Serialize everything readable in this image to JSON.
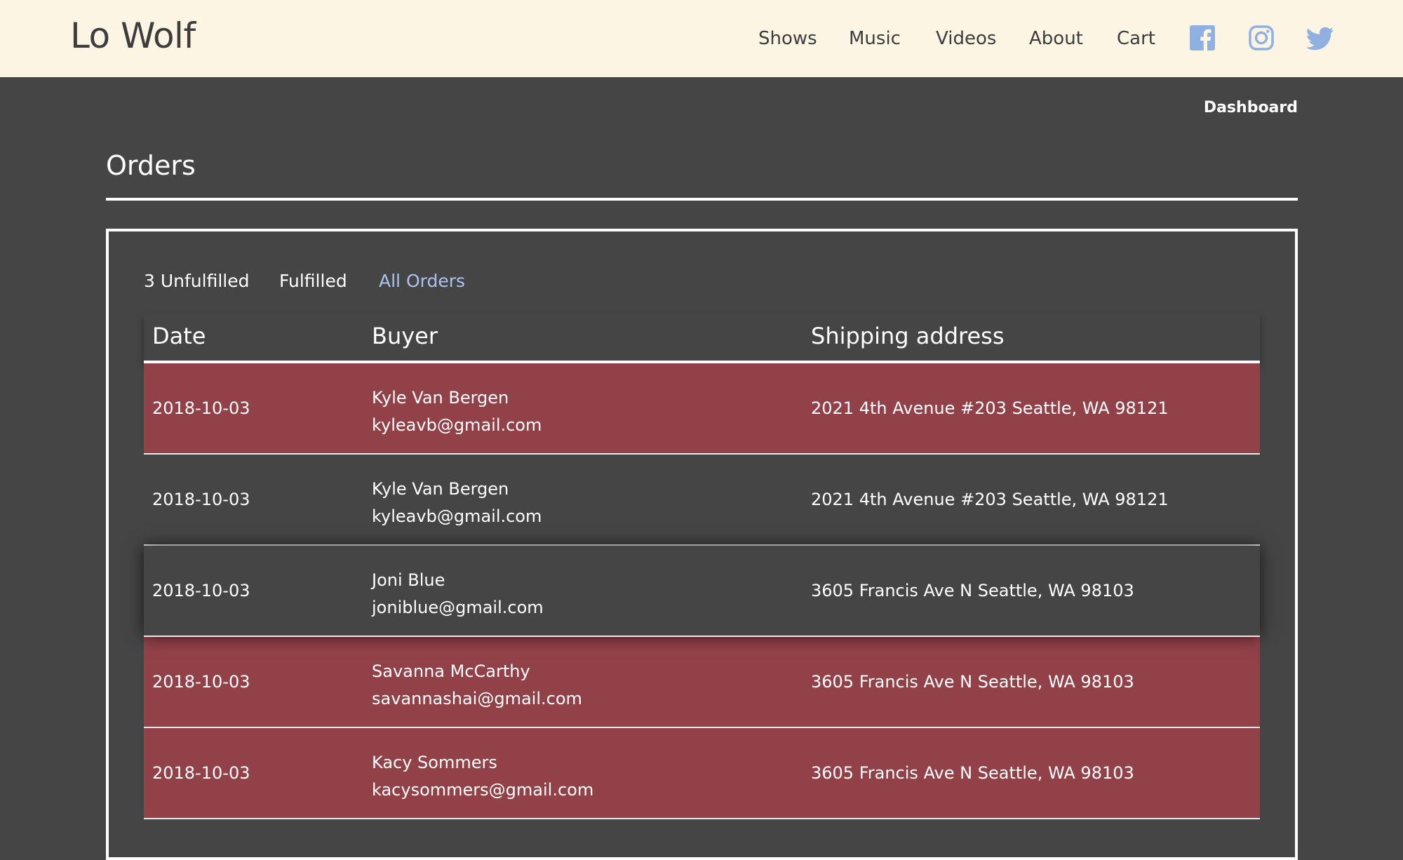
{
  "header": {
    "brand": "Lo Wolf",
    "nav": [
      "Shows",
      "Music",
      "Videos",
      "About",
      "Cart"
    ],
    "social_icons": [
      "facebook-icon",
      "instagram-icon",
      "twitter-icon"
    ],
    "social_color": "#8fb0e0"
  },
  "dashboard_link": "Dashboard",
  "page_title": "Orders",
  "tabs": [
    "3 Unfulfilled",
    "Fulfilled",
    "All Orders"
  ],
  "active_tab": "All Orders",
  "colors": {
    "header_bg": "#fdf5e4",
    "page_bg": "#454545",
    "unfulfilled_row": "#934149",
    "active_tab": "#a9c4f0"
  },
  "table": {
    "columns": [
      "Date",
      "Buyer",
      "Shipping address"
    ],
    "rows": [
      {
        "date": "2018-10-03",
        "buyer_name": "Kyle Van Bergen",
        "buyer_email": "kyleavb@gmail.com",
        "address": "2021 4th Avenue #203 Seattle, WA 98121",
        "status": "unfulfilled"
      },
      {
        "date": "2018-10-03",
        "buyer_name": "Kyle Van Bergen",
        "buyer_email": "kyleavb@gmail.com",
        "address": "2021 4th Avenue #203 Seattle, WA 98121",
        "status": "fulfilled"
      },
      {
        "date": "2018-10-03",
        "buyer_name": "Joni Blue",
        "buyer_email": "joniblue@gmail.com",
        "address": "3605 Francis Ave N Seattle, WA 98103",
        "status": "hovered"
      },
      {
        "date": "2018-10-03",
        "buyer_name": "Savanna McCarthy",
        "buyer_email": "savannashai@gmail.com",
        "address": "3605 Francis Ave N Seattle, WA 98103",
        "status": "unfulfilled"
      },
      {
        "date": "2018-10-03",
        "buyer_name": "Kacy Sommers",
        "buyer_email": "kacysommers@gmail.com",
        "address": "3605 Francis Ave N Seattle, WA 98103",
        "status": "unfulfilled"
      }
    ]
  }
}
